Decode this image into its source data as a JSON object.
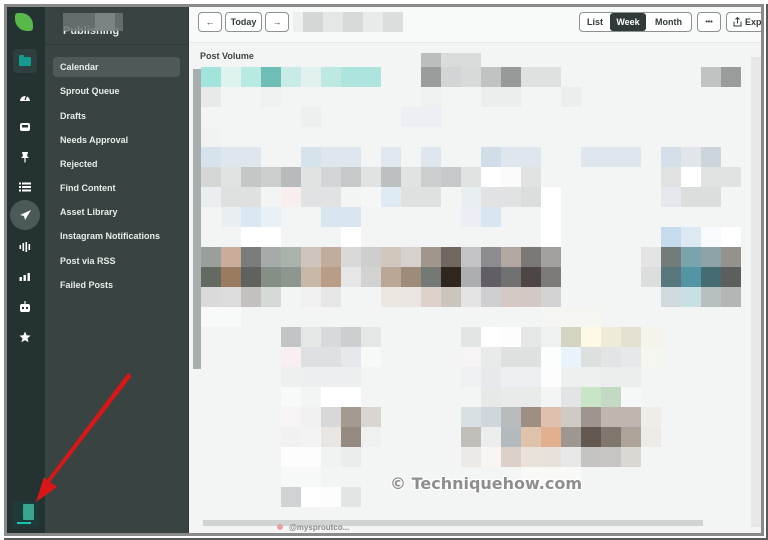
{
  "sidebar": {
    "section_title": "Publishing",
    "items": [
      {
        "label": "Calendar",
        "active": true
      },
      {
        "label": "Sprout Queue"
      },
      {
        "label": "Drafts"
      },
      {
        "label": "Needs Approval"
      },
      {
        "label": "Rejected"
      },
      {
        "label": "Find Content"
      },
      {
        "label": "Asset Library"
      },
      {
        "label": "Instagram Notifications"
      },
      {
        "label": "Post via RSS"
      },
      {
        "label": "Failed Posts"
      }
    ]
  },
  "rail": {
    "icons": [
      "folder-icon",
      "dashboard-icon",
      "inbox-icon",
      "pin-icon",
      "list-icon",
      "send-icon",
      "listening-icon",
      "reports-icon",
      "bot-icon",
      "star-icon"
    ],
    "active": "send-icon"
  },
  "toolbar": {
    "prev_symbol": "←",
    "today_label": "Today",
    "next_symbol": "→",
    "views": [
      "List",
      "Week",
      "Month"
    ],
    "active_view": "Week",
    "more_symbol": "•••",
    "export_label": "Exp",
    "export_icon": "share-icon"
  },
  "main": {
    "post_volume_label": "Post Volume",
    "handle_label": "@mysproutco..."
  },
  "watermark": "© Techniquehow.com",
  "colors": {
    "brand_green": "#58b84a",
    "accent_teal": "#139b8e",
    "rail_bg": "#253232",
    "subnav_bg": "#384342",
    "annotation_red": "#e01010"
  }
}
